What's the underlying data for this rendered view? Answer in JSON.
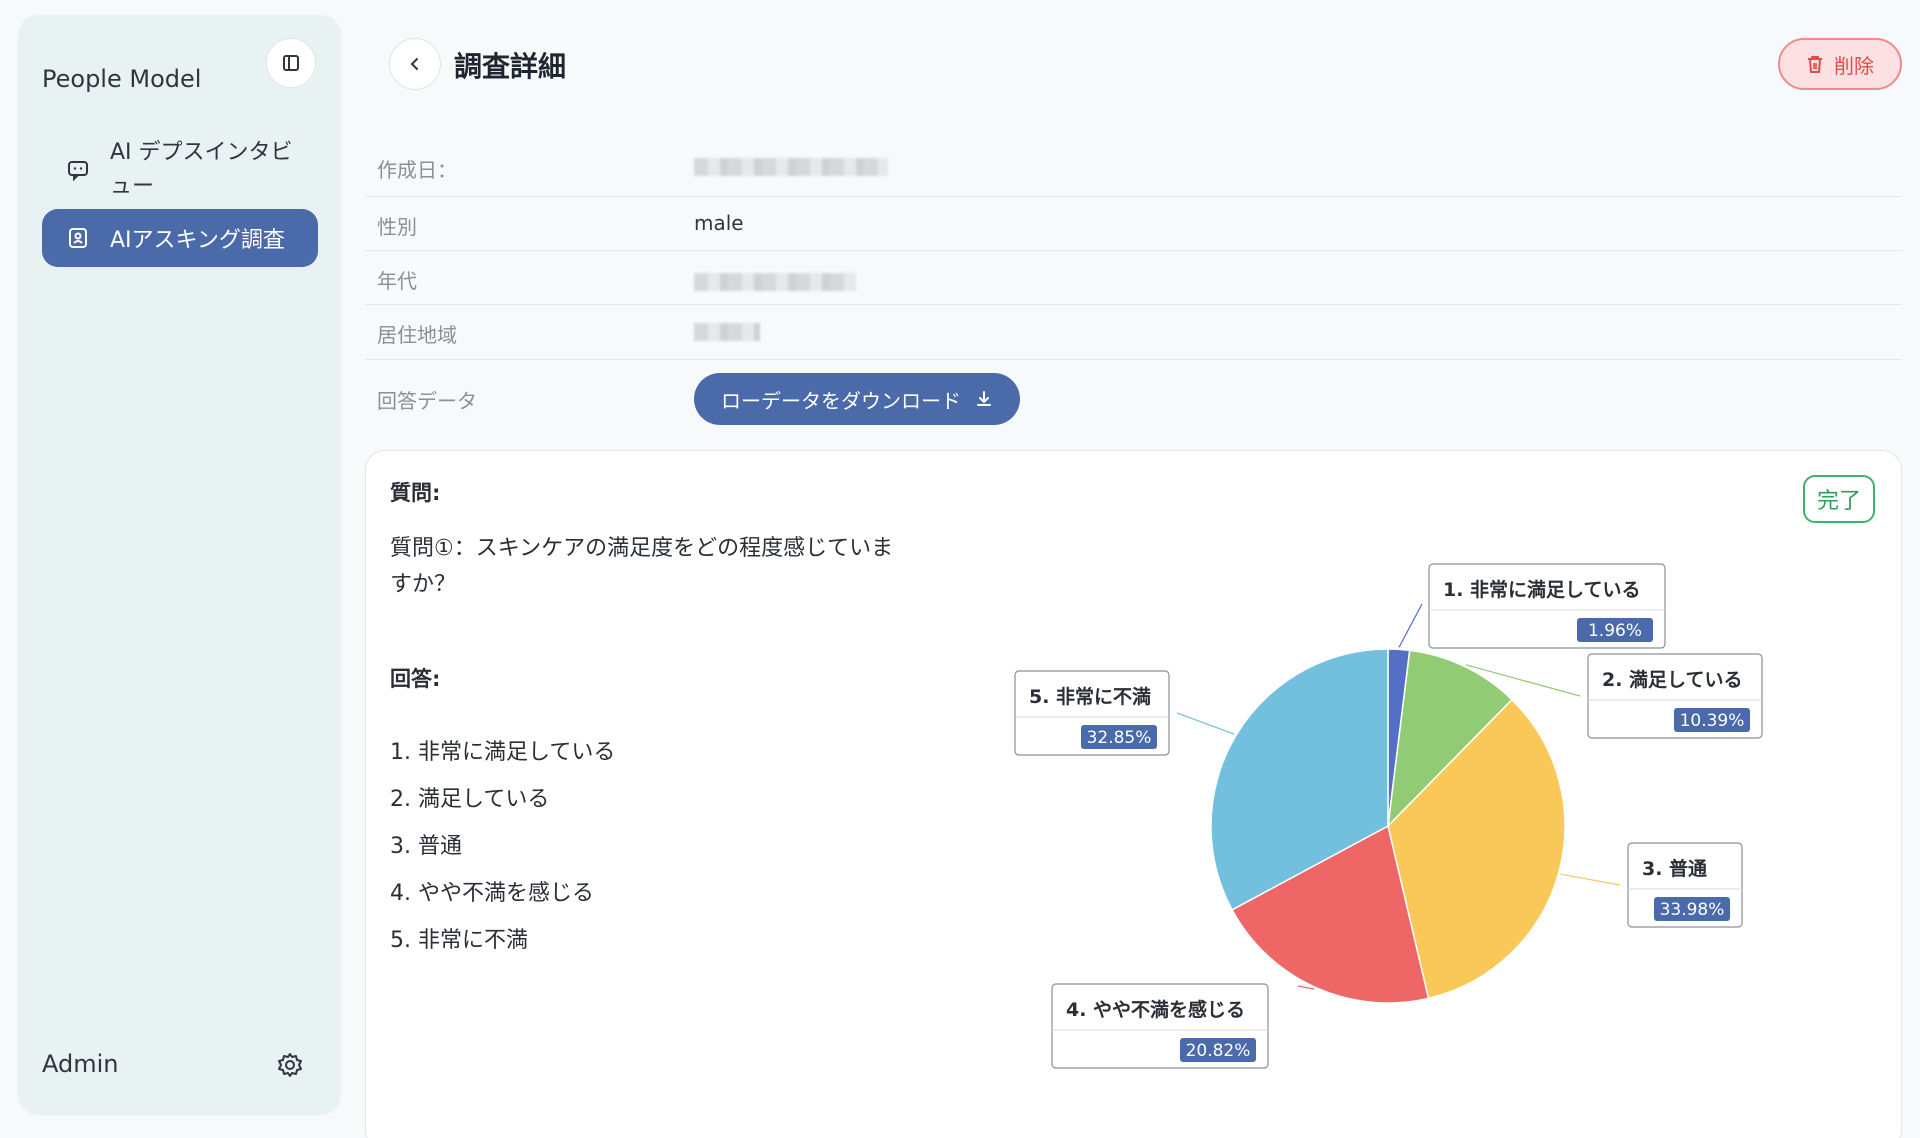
{
  "app": {
    "name": "People Model"
  },
  "sidebar": {
    "items": [
      {
        "label": "AI デプスインタビュー",
        "icon": "chat-icon"
      },
      {
        "label": "AIアスキング調査",
        "icon": "survey-icon",
        "active": true
      }
    ],
    "user": "Admin"
  },
  "header": {
    "title": "調査詳細",
    "delete_label": "削除"
  },
  "info": {
    "created_label": "作成日：",
    "gender_label": "性別",
    "gender_value": "male",
    "age_label": "年代",
    "region_label": "居住地域",
    "answer_data_label": "回答データ",
    "download_label": "ローデータをダウンロード"
  },
  "question": {
    "title": "質問:",
    "text": "質問①：スキンケアの満足度をどの程度感じていますか？",
    "answers_title": "回答:",
    "answers": [
      "1. 非常に満足している",
      "2. 満足している",
      "3. 普通",
      "4. やや不満を感じる",
      "5. 非常に不満"
    ],
    "status": "完了"
  },
  "colors": {
    "accent": "#4a6aaa",
    "danger": "#e14b4b",
    "success": "#2e9e58"
  },
  "chart_data": {
    "type": "pie",
    "categories": [
      "1. 非常に満足している",
      "2. 満足している",
      "3. 普通",
      "4. やや不満を感じる",
      "5. 非常に不満"
    ],
    "values": [
      1.96,
      10.39,
      33.98,
      20.82,
      32.85
    ],
    "value_labels": [
      "1.96%",
      "10.39%",
      "33.98%",
      "20.82%",
      "32.85%"
    ],
    "colors": [
      "#5470c6",
      "#91cc75",
      "#fac858",
      "#ee6666",
      "#73c0de"
    ]
  }
}
